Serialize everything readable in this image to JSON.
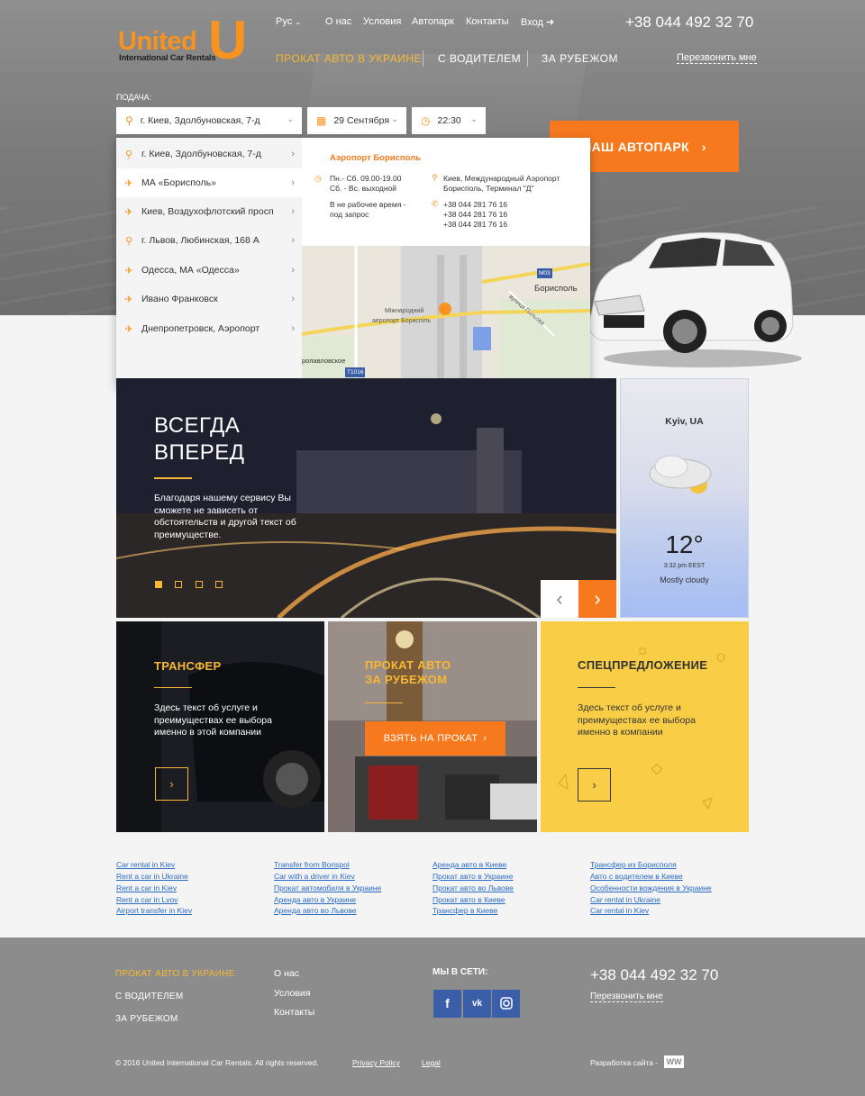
{
  "header": {
    "logo": {
      "text": "United",
      "letter": "U",
      "subtitle": "International Car Rentals"
    },
    "lang": "Рус",
    "top_links": [
      "О нас",
      "Условия",
      "Автопарк",
      "Контакты",
      "Вход"
    ],
    "phone": "+38 044 492 32 70",
    "callback": "Перезвонить мне",
    "main_nav": [
      "ПРОКАТ АВТО В УКРАИНЕ",
      "С ВОДИТЕЛЕМ",
      "ЗА РУБЕЖОМ"
    ]
  },
  "booking": {
    "label": "ПОДАЧА:",
    "location": "г. Киев, Здолбуновская, 7-д",
    "date": "29 Сентября",
    "time": "22:30",
    "fleet_button": "НАШ АВТОПАРК"
  },
  "dropdown": {
    "items": [
      {
        "label": "г. Киев, Здолбуновская, 7-д",
        "icon": "pin-icon"
      },
      {
        "label": "МА «Борисполь»",
        "icon": "plane-icon"
      },
      {
        "label": "Киев, Воздухофлотский просп",
        "icon": "plane-icon"
      },
      {
        "label": "г. Львов, Любинская, 168 А",
        "icon": "pin-icon"
      },
      {
        "label": "Одесса, МА «Одесса»",
        "icon": "plane-icon"
      },
      {
        "label": "Ивано Франковск",
        "icon": "plane-icon"
      },
      {
        "label": "Днепропетровск,  Аэропорт",
        "icon": "plane-icon"
      }
    ],
    "info": {
      "title": "Аэропорт Борисполь",
      "hours_1": "Пн.- Сб. 09.00-19.00",
      "hours_2": "Сб. - Вс. выходной",
      "hours_note_1": "В не рабочее время -",
      "hours_note_2": "под запрос",
      "address_1": "Киев, Международный Аэропорт",
      "address_2": "Борисполь, Терминал \"Д\"",
      "phones": [
        "+38 044 281 76 16",
        "+38 044 281 76 16",
        "+38 044 281 76 16"
      ]
    },
    "map": {
      "city": "Борисполь",
      "airport_1": "Міжнародний",
      "airport_2": "аеропорт Бориспіль",
      "road_m03": "M03",
      "road_t1016": "T1016",
      "village": "ропавловское",
      "street": "вулиця Польова"
    }
  },
  "slider": {
    "title_1": "ВСЕГДА",
    "title_2": "ВПЕРЕД",
    "text": "Благодаря нашему сервису Вы сможете не зависеть от обстоятельств и другой текст об преимуществе.",
    "dots": 4,
    "active_dot": 0
  },
  "weather": {
    "city": "Kyiv, UA",
    "temp": "12",
    "time": "3:32 pm EEST",
    "desc": "Mostly cloudy"
  },
  "cards": [
    {
      "title": "ТРАНСФЕР",
      "text": "Здесь текст об услуге и преимуществах ее выбора именно в этой компании"
    },
    {
      "title_1": "ПРОКАТ АВТО",
      "title_2": "ЗА РУБЕЖОМ",
      "button": "ВЗЯТЬ НА ПРОКАТ"
    },
    {
      "title": "СПЕЦПРЕДЛОЖЕНИЕ",
      "text": "Здесь текст об услуге и преимуществах ее выбора именно в компании"
    }
  ],
  "links": [
    [
      "Car rental in Kiev",
      "Rent a car in Ukraine",
      "Rent a car in Kiev",
      "Rent a car in Lvov",
      "Airport transfer in Kiev"
    ],
    [
      "Transfer from Borispol",
      "Car with a driver in Kiev",
      "Прокат автомобиля в Украине",
      "Аренда авто в Украине",
      "Аренда авто во Львове"
    ],
    [
      "Аренда авто в Киеве",
      "Прокат авто в Украине",
      "Прокат авто во Львове",
      "Прокат авто в Киеве",
      "Трансфер в Киеве"
    ],
    [
      "Трансфер из Борисполя",
      "Авто с водителем в Киеве",
      "Особенности вождения в Украине",
      "Car rental in Ukraine",
      "Car rental in Kiev"
    ]
  ],
  "footer": {
    "nav": [
      "ПРОКАТ АВТО В УКРАИНЕ",
      "С ВОДИТЕЛЕМ",
      "ЗА РУБЕЖОМ"
    ],
    "links": [
      "О нас",
      "Условия",
      "Контакты"
    ],
    "social_title": "МЫ В СЕТИ:",
    "social": [
      "f",
      "vk",
      "ig"
    ],
    "phone": "+38 044 492 32 70",
    "callback": "Перезвонить мне",
    "copyright": "© 2016 United International Car Rentals. All rights reserved.",
    "privacy": "Privacy Policy",
    "legal": "Legal",
    "dev": "Разработка сайта -",
    "dev_logo": "WW"
  },
  "colors": {
    "accent": "#f7791e",
    "gold": "#f7b733",
    "card_yellow": "#f9cd45",
    "link": "#2a6cc4"
  }
}
